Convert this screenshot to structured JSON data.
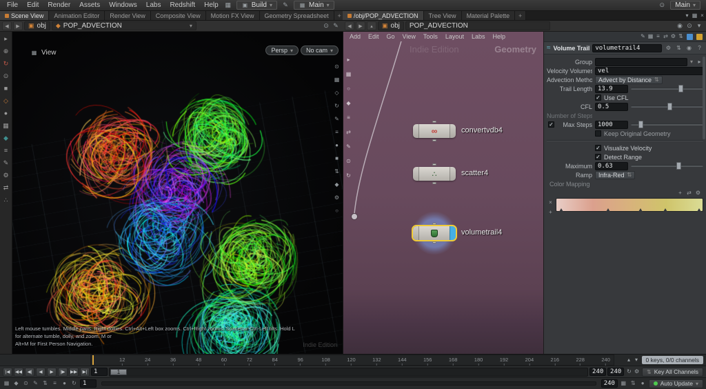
{
  "icons": {
    "chevron_down": "▾",
    "chevron_up": "▴",
    "chevron_right": "▸",
    "back": "◀",
    "forward": "▶",
    "close": "×",
    "plus": "+",
    "minus": "−",
    "check": "✓",
    "gear": "⚙",
    "pen": "✎",
    "grid": "▦",
    "list": "≡",
    "swap": "⇄",
    "updown": "⇅",
    "loop": "↻",
    "dot": "●",
    "ring": "○",
    "diamond": "◆",
    "square": "■",
    "help": "?",
    "cube": "▣",
    "infinity": "∞",
    "scatter": "∴",
    "wave": "≈",
    "pin": "◉",
    "target": "⊙"
  },
  "icon_strips": {
    "main_left": [
      "▸",
      "⊕",
      "↻",
      "⊙",
      "■",
      "◇",
      "●",
      "▦",
      "◆",
      "≡",
      "✎",
      "⚙",
      "⇄",
      "∴"
    ],
    "viewport_right": [
      "⊙",
      "▦",
      "◇",
      "↻",
      "✎",
      "≡",
      "●",
      "■",
      "⇅",
      "◆",
      "⚙",
      "○"
    ],
    "network_left": [
      "▸",
      "▦",
      "○",
      "◆",
      "≡",
      "⇄",
      "✎",
      "⊙",
      "↻"
    ],
    "playbar_options": [
      "▦",
      "◆",
      "⊙",
      "✎",
      "⇅",
      "≡",
      "●",
      "↻"
    ],
    "param_toolbar": [
      "✎",
      "▦",
      "≡",
      "⇄",
      "⚙",
      "⇅"
    ],
    "pane_controls_left": [
      "▾",
      "▦",
      "×"
    ],
    "pane_controls_right": [
      "▾",
      "▦",
      "×"
    ],
    "left_path_right": [
      "⊙",
      "✎"
    ],
    "right_path_right": [
      "◉",
      "⊙",
      "▾"
    ],
    "ruler_right": [
      "▴",
      "▾"
    ],
    "transport_right": [
      "↻",
      "⚙"
    ],
    "status_right": [
      "▦",
      "⇅",
      "●"
    ]
  },
  "transport_buttons": [
    "|◀",
    "◀◀",
    "◀|",
    "◀",
    "▶",
    "|▶",
    "▶▶",
    "▶|"
  ],
  "menubar": {
    "menus": [
      "File",
      "Edit",
      "Render",
      "Assets",
      "Windows",
      "Labs",
      "Redshift",
      "Help"
    ],
    "build_label": "Build",
    "desktop_label": "Main",
    "take_label": "Main"
  },
  "left_pane": {
    "tabs": [
      "Scene View",
      "Animation Editor",
      "Render View",
      "Composite View",
      "Motion FX View",
      "Geometry Spreadsheet"
    ],
    "new_tab": "+",
    "path_root": "obj",
    "path_network": "POP_ADVECTION",
    "viewport": {
      "view_label": "View",
      "persp_label": "Persp",
      "cam_label": "No cam",
      "help_line1": "Left mouse tumbles. Middle pans. Right dollies. Ctrl+Alt+Left box zooms. Ctrl+Right zooms. Spacebar-Ctrl-Left tilts. Hold L for alternate tumble, dolly, and zoom. M or",
      "help_line2": "Alt+M for First Person Navigation.",
      "watermark": "Indie Edition"
    }
  },
  "network_pane": {
    "tabs": [
      "/obj/POP_ADVECTION",
      "Tree View",
      "Material Palette"
    ],
    "new_tab": "+",
    "menus": [
      "Add",
      "Edit",
      "Go",
      "View",
      "Tools",
      "Layout",
      "Labs",
      "Help"
    ],
    "path_root": "obj",
    "path_network": "POP_ADVECTION",
    "watermark_edition": "Indie Edition",
    "watermark_context": "Geometry",
    "nodes": [
      {
        "label": "convertvdb4"
      },
      {
        "label": "scatter4"
      },
      {
        "label": "volumetrail4"
      }
    ]
  },
  "params": {
    "node_type": "Volume Trail",
    "node_name": "volumetrail4",
    "group_label": "Group",
    "velocity_label": "Velocity Volumes",
    "velocity_value": "vel",
    "advection_label": "Advection Method",
    "advection_value": "Advect by Distance",
    "trail_label": "Trail Length",
    "trail_value": "13.9",
    "use_cfl_label": "Use CFL",
    "cfl_label": "CFL",
    "cfl_value": "0.5",
    "num_steps_label": "Number of Steps",
    "max_steps_label": "Max Steps",
    "max_steps_value": "1000",
    "keep_label": "Keep Original Geometry",
    "visualize_label": "Visualize Velocity",
    "detect_label": "Detect Range",
    "maximum_label": "Maximum",
    "maximum_value": "0.63",
    "ramp_label": "Ramp",
    "ramp_value": "Infra-Red",
    "color_mapping_label": "Color Mapping",
    "ramp_colors": [
      "#e8cdc6",
      "#dba08d",
      "#d8b27c",
      "#cfc46a",
      "#dadc96"
    ]
  },
  "timeline": {
    "ticks": [
      12,
      24,
      36,
      48,
      60,
      72,
      84,
      96,
      108,
      120,
      132,
      144,
      156,
      168,
      180,
      192,
      204,
      216,
      228,
      240
    ],
    "current_frame": "1",
    "range_start": "1",
    "range_end": "240",
    "end_frame": "240",
    "global_start": "1",
    "global_end": "240",
    "keys_label": "0 keys, 0/0 channels",
    "key_all_label": "Key All Channels",
    "auto_update_label": "Auto Update"
  }
}
